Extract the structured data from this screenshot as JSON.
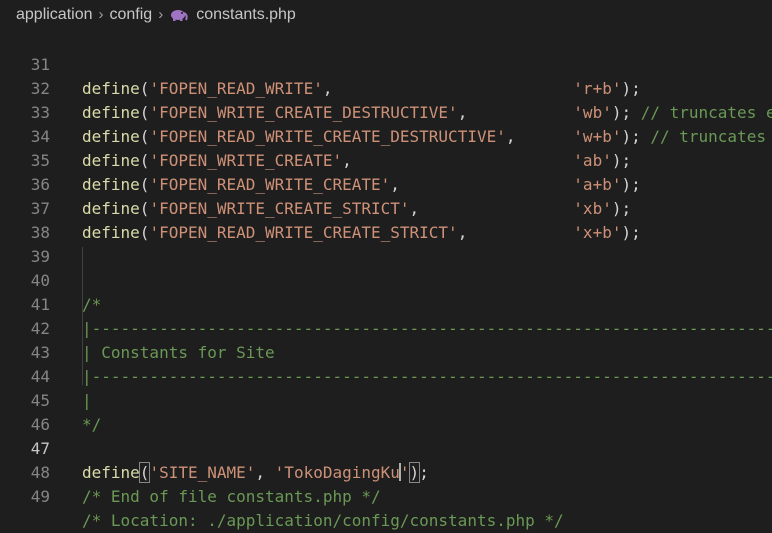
{
  "breadcrumb": {
    "part1": "application",
    "part2": "config",
    "file": "constants.php",
    "sep": "›"
  },
  "fn": "define",
  "lines": [
    {
      "n": "31",
      "k": "'FOPEN_READ_WRITE'",
      "p1": ",",
      "pad": "                         ",
      "v": "'r+b'",
      "end": ");",
      "c": ""
    },
    {
      "n": "32",
      "k": "'FOPEN_WRITE_CREATE_DESTRUCTIVE'",
      "p1": ",",
      "pad": "           ",
      "v": "'wb'",
      "end": ");",
      "c": " // truncates exi"
    },
    {
      "n": "33",
      "k": "'FOPEN_READ_WRITE_CREATE_DESTRUCTIVE'",
      "p1": ",",
      "pad": "      ",
      "v": "'w+b'",
      "end": ");",
      "c": " // truncates ex"
    },
    {
      "n": "34",
      "k": "'FOPEN_WRITE_CREATE'",
      "p1": ",",
      "pad": "                       ",
      "v": "'ab'",
      "end": ");",
      "c": ""
    },
    {
      "n": "35",
      "k": "'FOPEN_READ_WRITE_CREATE'",
      "p1": ",",
      "pad": "                  ",
      "v": "'a+b'",
      "end": ");",
      "c": ""
    },
    {
      "n": "36",
      "k": "'FOPEN_WRITE_CREATE_STRICT'",
      "p1": ",",
      "pad": "                ",
      "v": "'xb'",
      "end": ");",
      "c": ""
    },
    {
      "n": "37",
      "k": "'FOPEN_READ_WRITE_CREATE_STRICT'",
      "p1": ",",
      "pad": "           ",
      "v": "'x+b'",
      "end": ");",
      "c": ""
    }
  ],
  "ln": {
    "l38": "38",
    "l39": "39",
    "l40": "40",
    "l41": "41",
    "l42": "42",
    "l43": "43",
    "l44": "44",
    "l45": "45",
    "l46": "46",
    "l47": "47",
    "l48": "48",
    "l49": "49"
  },
  "comment_block": {
    "open": "/*",
    "rule": "|------------------------------------------------------------------------",
    "title": "| Constants for Site",
    "bar": "|",
    "close": "*/"
  },
  "site": {
    "open_paren": "(",
    "key": "'SITE_NAME'",
    "comma": ", ",
    "value_a": "'TokoDagingKu",
    "value_b": "'",
    "close": ");"
  },
  "footer": {
    "eof": "/* End of file constants.php */",
    "location": "/* Location: ./application/config/constants.php */"
  }
}
